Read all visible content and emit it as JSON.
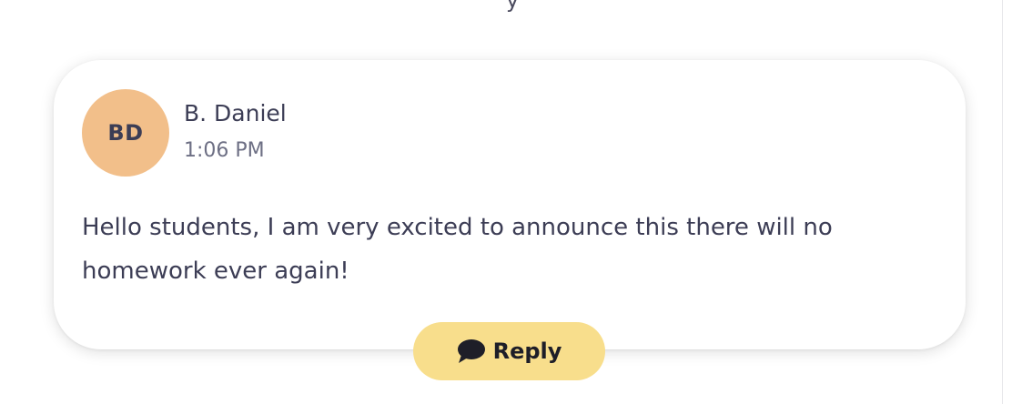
{
  "post": {
    "avatar_initials": "BD",
    "avatar_color": "#f2bf8a",
    "author": "B. Daniel",
    "time": "1:06 PM",
    "message": "Hello students, I am very excited to announce this there will no homework ever again!"
  },
  "reply_button": {
    "label": "Reply",
    "icon": "speech-bubble-icon",
    "color": "#f8de8c"
  },
  "colors": {
    "text_primary": "#3c3d55",
    "text_secondary": "#6d6f84"
  }
}
